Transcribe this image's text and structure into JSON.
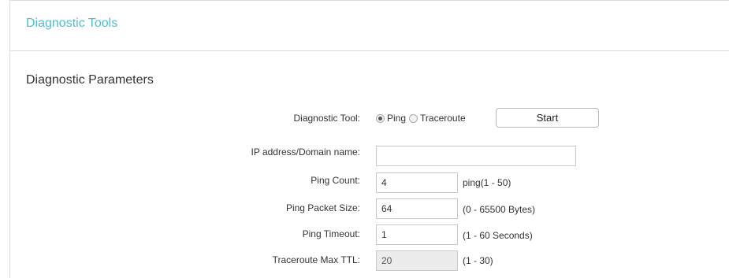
{
  "header": {
    "title": "Diagnostic Tools"
  },
  "section": {
    "title": "Diagnostic Parameters"
  },
  "diagnostic_tool": {
    "label": "Diagnostic Tool:",
    "options": [
      "Ping",
      "Traceroute"
    ],
    "selected": "Ping",
    "start_label": "Start"
  },
  "fields": {
    "ip_address": {
      "label": "IP address/Domain name:",
      "value": ""
    },
    "ping_count": {
      "label": "Ping Count:",
      "value": "4",
      "hint": "ping(1 - 50)"
    },
    "ping_packet_size": {
      "label": "Ping Packet Size:",
      "value": "64",
      "hint": "(0 - 65500 Bytes)"
    },
    "ping_timeout": {
      "label": "Ping Timeout:",
      "value": "1",
      "hint": "(1 - 60 Seconds)"
    },
    "traceroute_max_ttl": {
      "label": "Traceroute Max TTL:",
      "value": "20",
      "hint": "(1 - 30)",
      "disabled": true
    }
  },
  "colors": {
    "title": "#4bbfd0",
    "text": "#333333",
    "border": "#dcdcdc",
    "disabled_bg": "#ececec"
  }
}
